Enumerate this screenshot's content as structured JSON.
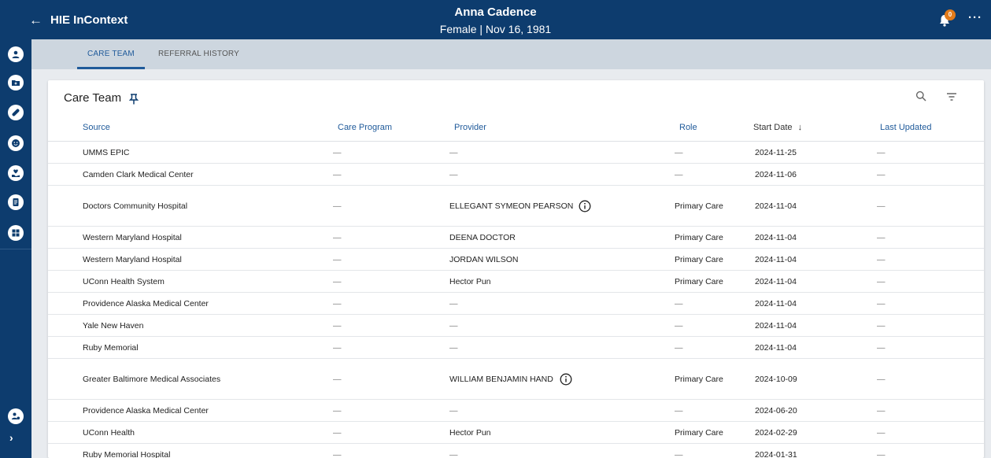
{
  "header": {
    "back_glyph": "←",
    "app_title": "HIE InContext",
    "patient_name": "Anna Cadence",
    "patient_info": "Female | Nov 16, 1981",
    "notification_count": "0",
    "more_glyph": "···"
  },
  "sidebar": {
    "icons": [
      "user-circle-icon",
      "folder-plus-icon",
      "pill-icon",
      "smiley-icon",
      "heart-hand-icon",
      "document-icon",
      "dashboard-grid-icon",
      "user-settings-icon"
    ],
    "expand_glyph": "›"
  },
  "tabs": [
    {
      "label": "CARE TEAM",
      "active": true
    },
    {
      "label": "REFERRAL HISTORY",
      "active": false
    }
  ],
  "card": {
    "title": "Care Team",
    "columns": {
      "source": "Source",
      "care_program": "Care Program",
      "provider": "Provider",
      "role": "Role",
      "start_date": "Start Date",
      "sort_glyph": "↓",
      "last_updated": "Last Updated"
    },
    "rows": [
      {
        "source": "UMMS EPIC",
        "care_program": "—",
        "provider": "—",
        "role": "—",
        "start_date": "2024-11-25",
        "last_updated": "—"
      },
      {
        "source": "Camden Clark Medical Center",
        "care_program": "—",
        "provider": "—",
        "role": "—",
        "start_date": "2024-11-06",
        "last_updated": "—"
      },
      {
        "source": "Doctors Community Hospital",
        "care_program": "—",
        "provider": "ELLEGANT SYMEON PEARSON",
        "role": "Primary Care",
        "start_date": "2024-11-04",
        "last_updated": "—"
      },
      {
        "source": "Western Maryland Hospital",
        "care_program": "—",
        "provider": "DEENA DOCTOR",
        "role": "Primary Care",
        "start_date": "2024-11-04",
        "last_updated": "—"
      },
      {
        "source": "Western Maryland Hospital",
        "care_program": "—",
        "provider": "JORDAN WILSON",
        "role": "Primary Care",
        "start_date": "2024-11-04",
        "last_updated": "—"
      },
      {
        "source": "UConn Health System",
        "care_program": "—",
        "provider": "Hector Pun",
        "role": "Primary Care",
        "start_date": "2024-11-04",
        "last_updated": "—"
      },
      {
        "source": "Providence Alaska Medical Center",
        "care_program": "—",
        "provider": "—",
        "role": "—",
        "start_date": "2024-11-04",
        "last_updated": "—"
      },
      {
        "source": "Yale New Haven",
        "care_program": "—",
        "provider": "—",
        "role": "—",
        "start_date": "2024-11-04",
        "last_updated": "—"
      },
      {
        "source": "Ruby Memorial",
        "care_program": "—",
        "provider": "—",
        "role": "—",
        "start_date": "2024-11-04",
        "last_updated": "—"
      },
      {
        "source": "Greater Baltimore Medical Associates",
        "care_program": "—",
        "provider": "WILLIAM BENJAMIN HAND",
        "role": "Primary Care",
        "start_date": "2024-10-09",
        "last_updated": "—"
      },
      {
        "source": "Providence Alaska Medical Center",
        "care_program": "—",
        "provider": "—",
        "role": "—",
        "start_date": "2024-06-20",
        "last_updated": "—"
      },
      {
        "source": "UConn Health",
        "care_program": "—",
        "provider": "Hector Pun",
        "role": "Primary Care",
        "start_date": "2024-02-29",
        "last_updated": "—"
      },
      {
        "source": "Ruby Memorial Hospital",
        "care_program": "—",
        "provider": "—",
        "role": "—",
        "start_date": "2024-01-31",
        "last_updated": "—"
      }
    ]
  },
  "colors": {
    "nav_background": "#0d3c6e",
    "accent": "#1f5a9a",
    "badge": "#e27b1a",
    "tab_bar": "#cdd6df"
  }
}
